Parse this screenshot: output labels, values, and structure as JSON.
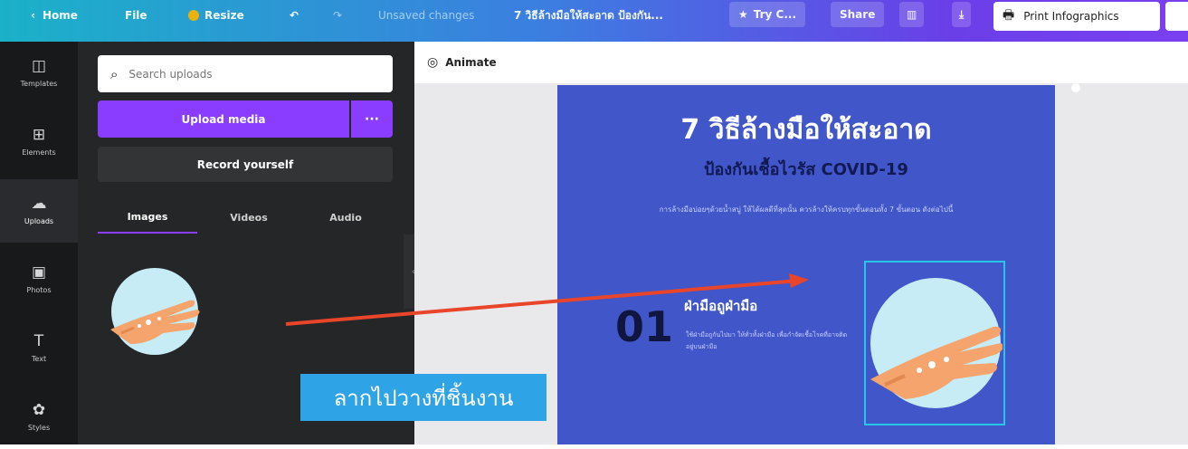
{
  "topbar": {
    "home": "Home",
    "file": "File",
    "resize": "Resize",
    "unsaved": "Unsaved changes",
    "doc_title": "7 วิธีล้างมือให้สะอาด ป้องกัน...",
    "try": "Try C...",
    "share": "Share",
    "print_label": "Print Infographics"
  },
  "sidebar": {
    "items": [
      {
        "label": "Templates",
        "icon": "templates-icon"
      },
      {
        "label": "Elements",
        "icon": "elements-icon"
      },
      {
        "label": "Uploads",
        "icon": "uploads-icon"
      },
      {
        "label": "Photos",
        "icon": "photos-icon"
      },
      {
        "label": "Text",
        "icon": "text-icon"
      },
      {
        "label": "Styles",
        "icon": "styles-icon"
      }
    ]
  },
  "panel": {
    "search_placeholder": "Search uploads",
    "upload_label": "Upload media",
    "more_label": "···",
    "record_label": "Record yourself",
    "tabs": [
      "Images",
      "Videos",
      "Audio"
    ]
  },
  "canvas": {
    "animate_label": "Animate",
    "title": "7 วิธีล้างมือให้สะอาด",
    "subtitle": "ป้องกันเชื้อไวรัส COVID-19",
    "description": "การล้างมือบ่อยๆด้วยน้ำสบู่ ให้ได้ผลดีที่สุดนั้น ควรล้างให้ครบทุกขั้นตอนทั้ง 7 ขั้นตอน ดังต่อไปนี้",
    "step_number": "01",
    "step_title": "ฝ่ามือถูฝ่ามือ",
    "step_desc": "ใช้ฝ่ามือถูกันไปมา ให้ทั่วทั้งฝ่ามือ เพื่อกำจัดเชื้อโรคที่อาจติดอยู่บนฝ่ามือ"
  },
  "caption": "ลากไปวางที่ชิ้นงาน",
  "colors": {
    "accent": "#8b3dff",
    "design_bg": "#4156c8",
    "caption_bg": "#2ea3e6",
    "arrow": "#e8452a"
  }
}
